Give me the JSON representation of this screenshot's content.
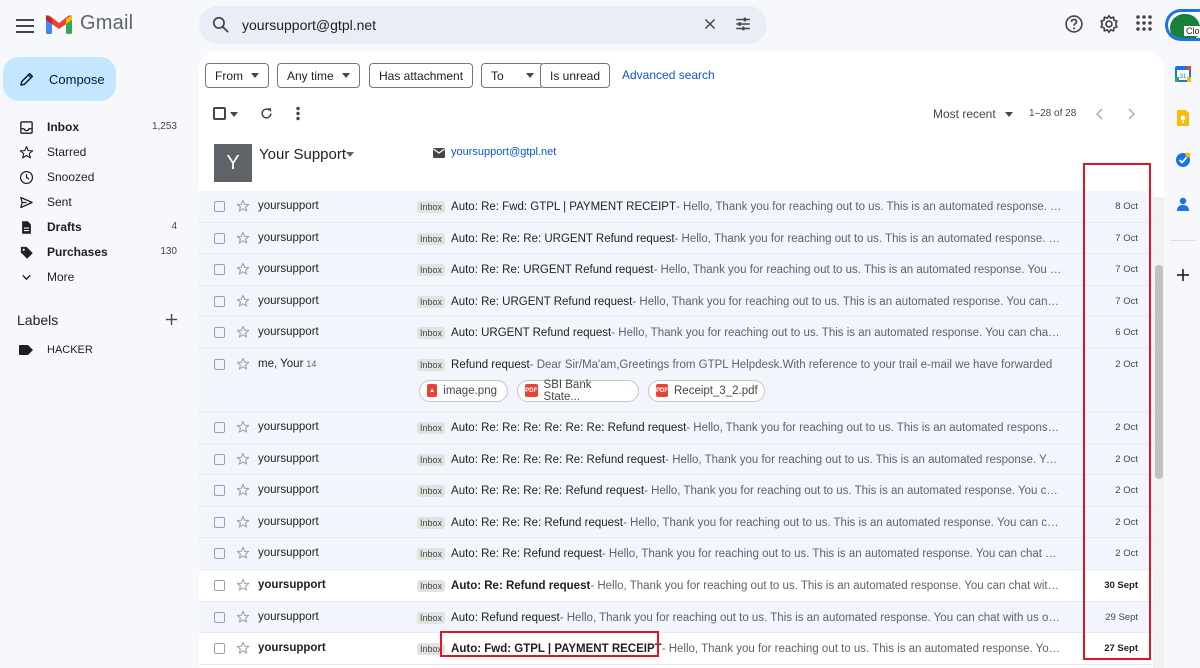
{
  "app": {
    "name": "Gmail"
  },
  "search": {
    "query": "yoursupport@gtpl.net"
  },
  "account": {
    "avatar_text": "Clos"
  },
  "compose": {
    "label": "Compose"
  },
  "nav": [
    {
      "label": "Inbox",
      "count": "1,253",
      "icon": "inbox-icon",
      "bold": true
    },
    {
      "label": "Starred",
      "count": "",
      "icon": "star-icon",
      "bold": false
    },
    {
      "label": "Snoozed",
      "count": "",
      "icon": "clock-icon",
      "bold": false
    },
    {
      "label": "Sent",
      "count": "",
      "icon": "send-icon",
      "bold": false
    },
    {
      "label": "Drafts",
      "count": "4",
      "icon": "draft-icon",
      "bold": true
    },
    {
      "label": "Purchases",
      "count": "130",
      "icon": "tag-icon",
      "bold": true
    },
    {
      "label": "More",
      "count": "",
      "icon": "chevron-down-icon",
      "bold": false
    }
  ],
  "labels": {
    "title": "Labels",
    "items": [
      {
        "label": "HACKER"
      }
    ]
  },
  "filters": {
    "from": "From",
    "any_time": "Any time",
    "has_attachment": "Has attachment",
    "to": "To",
    "is_unread": "Is unread",
    "advanced": "Advanced search"
  },
  "toolbar": {
    "sort": "Most recent",
    "range": "1–28 of 28"
  },
  "contact": {
    "initial": "Y",
    "name": "Your Support",
    "email": "yoursupport@gtpl.net"
  },
  "emails": [
    {
      "sender": "yoursupport",
      "count": "",
      "badge": "Inbox",
      "subject": "Auto: Re: Fwd: GTPL | PAYMENT RECEIPT",
      "snippet": " - Hello, Thank you for reaching out to us. This is an automated response. You can chat with us on GI",
      "date": "8 Oct",
      "unread": false
    },
    {
      "sender": "yoursupport",
      "count": "",
      "badge": "Inbox",
      "subject": "Auto: Re: Re: Re: URGENT Refund request",
      "snippet": " - Hello, Thank you for reaching out to us. This is an automated response. You can chat with us on GI",
      "date": "7 Oct",
      "unread": false
    },
    {
      "sender": "yoursupport",
      "count": "",
      "badge": "Inbox",
      "subject": "Auto: Re: Re: URGENT Refund request",
      "snippet": " - Hello, Thank you for reaching out to us. This is an automated response. You can chat with us on GI",
      "date": "7 Oct",
      "unread": false
    },
    {
      "sender": "yoursupport",
      "count": "",
      "badge": "Inbox",
      "subject": "Auto: Re: URGENT Refund request",
      "snippet": " - Hello, Thank you for reaching out to us. This is an automated response. You can chat with us on GI",
      "date": "7 Oct",
      "unread": false
    },
    {
      "sender": "yoursupport",
      "count": "",
      "badge": "Inbox",
      "subject": "Auto: URGENT Refund request",
      "snippet": " - Hello, Thank you for reaching out to us. This is an automated response. You can chat with us on GI",
      "date": "6 Oct",
      "unread": false
    },
    {
      "sender": "me, Your",
      "count": "14",
      "badge": "Inbox",
      "subject": "Refund request",
      "snippet": " - Dear Sir/Ma'am,Greetings from GTPL Helpdesk.With reference to your trail e-mail we have forwarded",
      "date": "2 Oct",
      "unread": false,
      "attachments": [
        "image.png",
        "SBI Bank State...",
        "Receipt_3_2.pdf"
      ]
    },
    {
      "sender": "yoursupport",
      "count": "",
      "badge": "Inbox",
      "subject": "Auto: Re: Re: Re: Re: Re: Re: Refund request",
      "snippet": " - Hello, Thank you for reaching out to us. This is an automated response. You can chat with us on GI",
      "date": "2 Oct",
      "unread": false
    },
    {
      "sender": "yoursupport",
      "count": "",
      "badge": "Inbox",
      "subject": "Auto: Re: Re: Re: Re: Re: Refund request",
      "snippet": " - Hello, Thank you for reaching out to us. This is an automated response. You can chat with us on GI",
      "date": "2 Oct",
      "unread": false
    },
    {
      "sender": "yoursupport",
      "count": "",
      "badge": "Inbox",
      "subject": "Auto: Re: Re: Re: Re: Refund request",
      "snippet": " - Hello, Thank you for reaching out to us. This is an automated response. You can chat with us on GI",
      "date": "2 Oct",
      "unread": false
    },
    {
      "sender": "yoursupport",
      "count": "",
      "badge": "Inbox",
      "subject": "Auto: Re: Re: Re: Refund request",
      "snippet": " - Hello, Thank you for reaching out to us. This is an automated response. You can chat with us on GI",
      "date": "2 Oct",
      "unread": false
    },
    {
      "sender": "yoursupport",
      "count": "",
      "badge": "Inbox",
      "subject": "Auto: Re: Re: Refund request",
      "snippet": " - Hello, Thank you for reaching out to us. This is an automated response. You can chat with us on GI",
      "date": "2 Oct",
      "unread": false
    },
    {
      "sender": "yoursupport",
      "count": "",
      "badge": "Inbox",
      "subject": "Auto: Re: Refund request",
      "snippet": " - Hello, Thank you for reaching out to us. This is an automated response. You can chat with us on GI",
      "date": "30 Sept",
      "unread": true
    },
    {
      "sender": "yoursupport",
      "count": "",
      "badge": "Inbox",
      "subject": "Auto: Refund request",
      "snippet": " - Hello, Thank you for reaching out to us. This is an automated response. You can chat with us on GI",
      "date": "29 Sept",
      "unread": false
    },
    {
      "sender": "yoursupport",
      "count": "",
      "badge": "Inbox",
      "subject": "Auto: Fwd: GTPL | PAYMENT RECEIPT",
      "snippet": " - Hello, Thank you for reaching out to us. This is an automated response. You can chat with us on GI",
      "date": "27 Sept",
      "unread": true
    }
  ],
  "colors": {
    "accent": "#0b57d0",
    "compose_bg": "#c2e7ff",
    "highlight": "#e1152a"
  }
}
